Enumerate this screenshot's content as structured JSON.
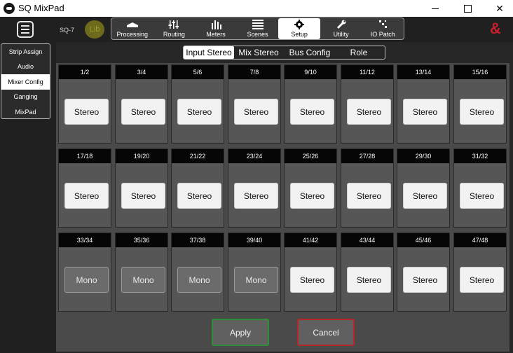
{
  "window": {
    "title": "SQ MixPad"
  },
  "header": {
    "device": "SQ-7",
    "lib_label": "Lib",
    "brand": "&",
    "tabs": [
      {
        "label": "Processing",
        "icon": "processing-icon"
      },
      {
        "label": "Routing",
        "icon": "routing-icon"
      },
      {
        "label": "Meters",
        "icon": "meters-icon"
      },
      {
        "label": "Scenes",
        "icon": "scenes-icon"
      },
      {
        "label": "Setup",
        "icon": "gear-icon",
        "active": true
      },
      {
        "label": "Utility",
        "icon": "wrench-icon"
      },
      {
        "label": "IO Patch",
        "icon": "io-patch-icon"
      }
    ]
  },
  "sidebar": {
    "items": [
      {
        "label": "Strip Assign"
      },
      {
        "label": "Audio"
      },
      {
        "label": "Mixer Config",
        "active": true
      },
      {
        "label": "Ganging"
      },
      {
        "label": "MixPad"
      }
    ]
  },
  "subtabs": [
    {
      "label": "Input Stereo",
      "active": true
    },
    {
      "label": "Mix Stereo"
    },
    {
      "label": "Bus Config"
    },
    {
      "label": "Role"
    }
  ],
  "channels": [
    {
      "label": "1/2",
      "mode": "Stereo"
    },
    {
      "label": "3/4",
      "mode": "Stereo"
    },
    {
      "label": "5/6",
      "mode": "Stereo"
    },
    {
      "label": "7/8",
      "mode": "Stereo"
    },
    {
      "label": "9/10",
      "mode": "Stereo"
    },
    {
      "label": "11/12",
      "mode": "Stereo"
    },
    {
      "label": "13/14",
      "mode": "Stereo"
    },
    {
      "label": "15/16",
      "mode": "Stereo"
    },
    {
      "label": "17/18",
      "mode": "Stereo"
    },
    {
      "label": "19/20",
      "mode": "Stereo"
    },
    {
      "label": "21/22",
      "mode": "Stereo"
    },
    {
      "label": "23/24",
      "mode": "Stereo"
    },
    {
      "label": "25/26",
      "mode": "Stereo"
    },
    {
      "label": "27/28",
      "mode": "Stereo"
    },
    {
      "label": "29/30",
      "mode": "Stereo"
    },
    {
      "label": "31/32",
      "mode": "Stereo"
    },
    {
      "label": "33/34",
      "mode": "Mono"
    },
    {
      "label": "35/36",
      "mode": "Mono"
    },
    {
      "label": "37/38",
      "mode": "Mono"
    },
    {
      "label": "39/40",
      "mode": "Mono"
    },
    {
      "label": "41/42",
      "mode": "Stereo"
    },
    {
      "label": "43/44",
      "mode": "Stereo"
    },
    {
      "label": "45/46",
      "mode": "Stereo"
    },
    {
      "label": "47/48",
      "mode": "Stereo"
    }
  ],
  "actions": {
    "apply_label": "Apply",
    "cancel_label": "Cancel"
  },
  "colors": {
    "brand": "#c8202a",
    "apply_border": "#2f8f36",
    "cancel_border": "#b8262c"
  }
}
